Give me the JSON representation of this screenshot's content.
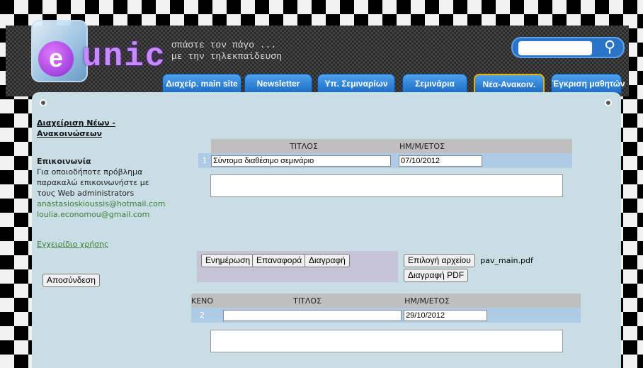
{
  "header": {
    "logo_e": "e",
    "logo_text": "unic",
    "slogan_line1": "σπάστε τον πάγο ...",
    "slogan_line2": "με την τηλεκπαίδευση"
  },
  "nav": {
    "tabs": [
      {
        "label": "Διαχείρ. main site"
      },
      {
        "label": "Newsletter"
      },
      {
        "label": "Υπ. Σεμιναρίων"
      },
      {
        "label": "Σεμινάρια"
      },
      {
        "label": "Νέα-Ανακοιν."
      },
      {
        "label": "Έγκριση μαθητών"
      }
    ],
    "active_tab": "Νέα-Ανακοιν."
  },
  "sidebar": {
    "title": "Διαχείριση Νέων - Ανακοινώσεων",
    "contact_heading": "Επικοινωνία",
    "contact_text": "Για οποιοδήποτε πρόβλημα παρακαλώ επικοινωνήστε με τους Web administrators",
    "email1": "anastasioskioussis@hotmail.com",
    "email2": "loulia.economou@gmail.com",
    "manual_link": "Εγχειρίδιο χρήσης",
    "logout_label": "Αποσύνδεση"
  },
  "record1": {
    "col_title": "ΤΙΤΛΟΣ",
    "col_date": "ΗΜ/Μ/ΕΤΟΣ",
    "row_num": "1",
    "title_value": "Σύντομα διαθέσιμο σεμινάριο",
    "date_value": "07/10/2012",
    "buttons": {
      "update": "Ενημέρωση",
      "reset": "Επαναφορά",
      "delete": "Διαγραφή"
    },
    "file_select": "Επιλογή αρχείου",
    "file_name": "pav_main.pdf",
    "delete_pdf": "Διαγραφή PDF"
  },
  "record2": {
    "col_empty": "ΚΕΝΟ",
    "col_title": "ΤΙΤΛΟΣ",
    "col_date": "ΗΜ/Μ/ΕΤΟΣ",
    "row_num": "2",
    "title_value": "",
    "date_value": "29/10/2012"
  },
  "colors": {
    "panel": "#c8dde4",
    "tab_blue": "#1c6dc5",
    "active_border": "#e8b000",
    "link_green": "#3f7d3a"
  }
}
